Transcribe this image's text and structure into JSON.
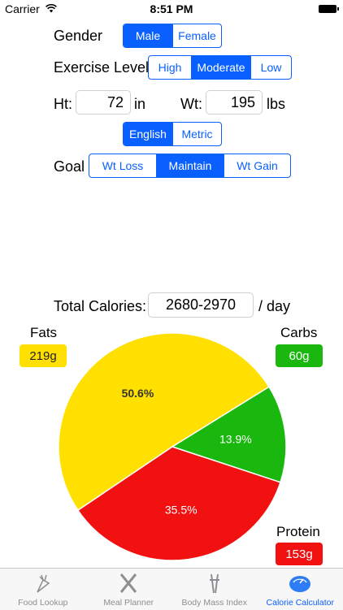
{
  "status_bar": {
    "carrier": "Carrier",
    "time": "8:51 PM"
  },
  "gender": {
    "label": "Gender",
    "options": [
      "Male",
      "Female"
    ],
    "selected": "Male"
  },
  "exercise": {
    "label": "Exercise Level",
    "options": [
      "High",
      "Moderate",
      "Low"
    ],
    "selected": "Moderate"
  },
  "height": {
    "label": "Ht:",
    "value": "72",
    "unit": "in"
  },
  "weight": {
    "label": "Wt:",
    "value": "195",
    "unit": "lbs"
  },
  "units": {
    "options": [
      "English",
      "Metric"
    ],
    "selected": "English"
  },
  "goal": {
    "label": "Goal",
    "options": [
      "Wt Loss",
      "Maintain",
      "Wt Gain"
    ],
    "selected": "Maintain"
  },
  "total": {
    "label": "Total Calories:",
    "value": "2680-2970",
    "unit": "/ day"
  },
  "macros": {
    "fats": {
      "name": "Fats",
      "grams": "219g",
      "percent": 50.6,
      "percent_label": "50.6%",
      "color": "#ffe000",
      "name_color": "#8a7300"
    },
    "carbs": {
      "name": "Carbs",
      "grams": "60g",
      "percent": 13.9,
      "percent_label": "13.9%",
      "color": "#1ab80f",
      "name_color": "#1a9a10"
    },
    "protein": {
      "name": "Protein",
      "grams": "153g",
      "percent": 35.5,
      "percent_label": "35.5%",
      "color": "#f11111",
      "name_color": "#b00000"
    }
  },
  "tabs": [
    {
      "label": "Food Lookup",
      "icon": "food-icon",
      "active": false
    },
    {
      "label": "Meal Planner",
      "icon": "fork-knife-icon",
      "active": false
    },
    {
      "label": "Body Mass Index",
      "icon": "calipers-icon",
      "active": false
    },
    {
      "label": "Calorie Calculator",
      "icon": "scale-icon",
      "active": true
    }
  ],
  "colors": {
    "accent": "#0a60ff"
  }
}
